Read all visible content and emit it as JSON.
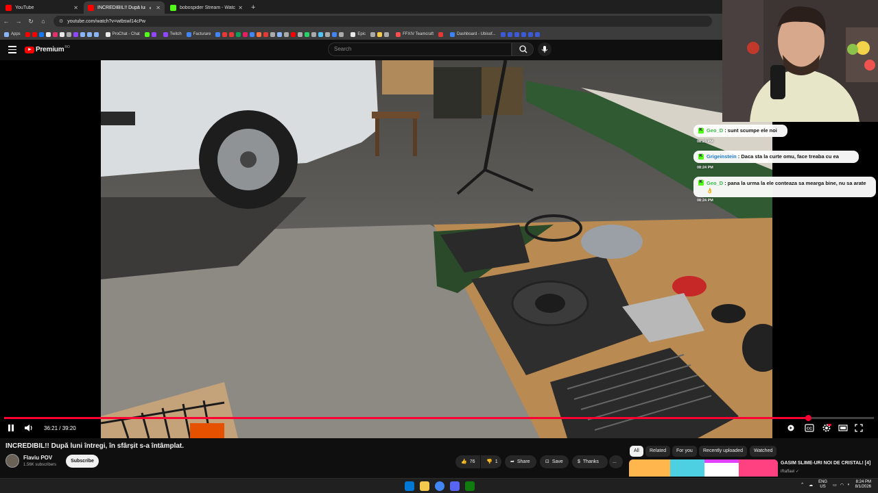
{
  "browser": {
    "tabs": [
      {
        "title": "YouTube",
        "favicon_color": "#ff0000",
        "active": false
      },
      {
        "title": "INCREDIBIL!! După luni într...",
        "favicon_color": "#ff0000",
        "active": true
      },
      {
        "title": "bobospider Stream - Watch Li...",
        "favicon_color": "#53fc18",
        "active": false
      }
    ],
    "new_tab": "+",
    "url": "youtube.com/watch?v=wtbswl14cPw",
    "bookmarks": [
      {
        "label": "Apps",
        "color": "#8ab4f8"
      },
      {
        "label": "ProChat - Chat",
        "color": "#e8e8e8"
      },
      {
        "label": "Twitch",
        "color": "#9146ff"
      },
      {
        "label": "Facturare",
        "color": "#4285f4"
      },
      {
        "label": "Epic",
        "color": "#e8e8e8"
      },
      {
        "label": "FFXIV Teamcraft",
        "color": "#ff4d4d"
      },
      {
        "label": "Dashboard - Ubisof...",
        "color": "#3c82f6"
      }
    ]
  },
  "youtube": {
    "logo_text": "Premium",
    "logo_badge": "RO",
    "search_placeholder": "Search"
  },
  "chat": [
    {
      "user": "Geo_D",
      "message": "sunt scumpe ele noi",
      "time": "08:23 PM"
    },
    {
      "user": "Grigeinstein",
      "message": "Daca sta la curte omu, face treaba cu ea",
      "time": "08:24 PM"
    },
    {
      "user": "Geo_D",
      "message": "pana la urma la ele conteaza sa mearga bine, nu sa arate 👌",
      "time": "08:24 PM"
    }
  ],
  "player": {
    "current_time": "36:21",
    "duration": "39:20",
    "time_display": "36:21 / 39:20",
    "progress_fraction": 0.924
  },
  "video": {
    "title": "INCREDIBIL!! După luni întregi, în sfârșit s-a întâmplat.",
    "channel": "Flaviu POV",
    "subscribers": "1.56K subscribers",
    "subscribe_label": "Subscribe",
    "likes": "76",
    "dislikes": "1",
    "share_label": "Share",
    "save_label": "Save",
    "thanks_label": "Thanks",
    "more_label": "..."
  },
  "chips": [
    "All",
    "Related",
    "For you",
    "Recently uploaded",
    "Watched"
  ],
  "recommended": {
    "title": "GASIM SLIME-URI NOI DE CRISTAL! [4]",
    "channel": "iRaffael"
  },
  "taskbar": {
    "lang": "ENG",
    "region": "US",
    "time": "8:24 PM",
    "date": "8/1/2026"
  }
}
